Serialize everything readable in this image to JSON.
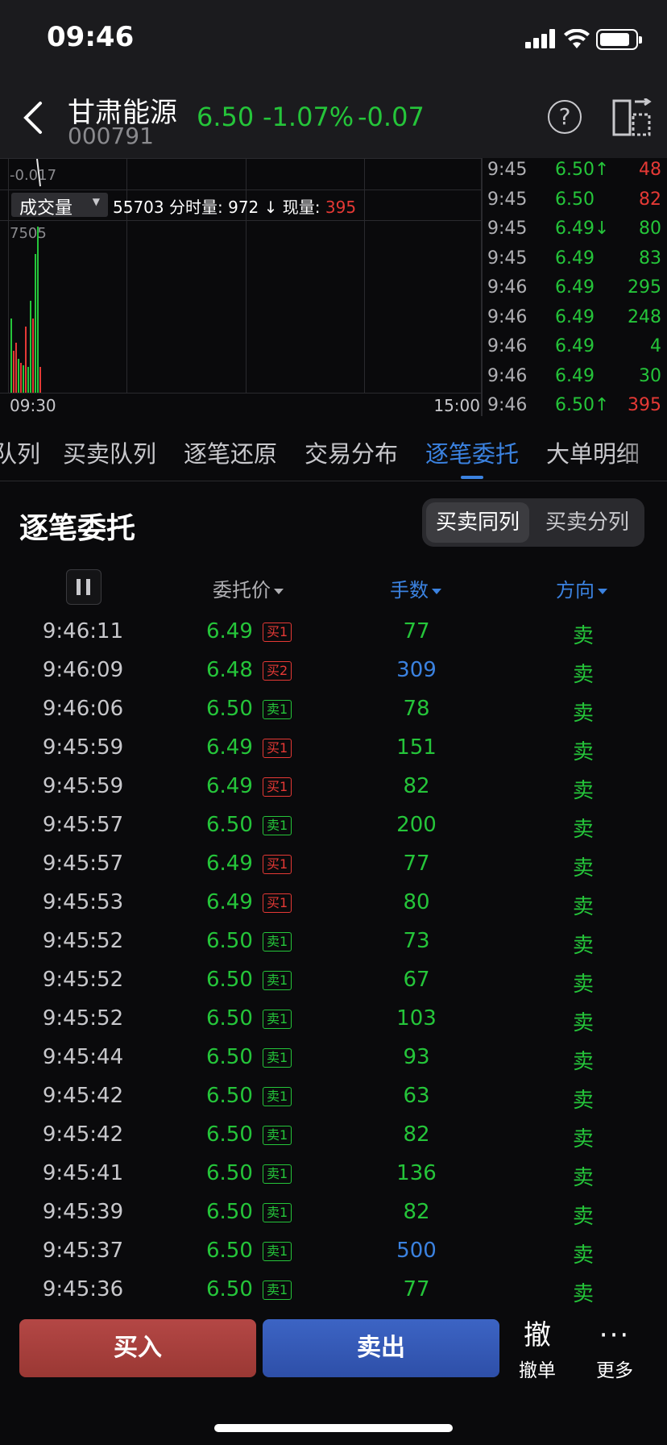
{
  "status": {
    "time": "09:46"
  },
  "stock": {
    "name": "甘肃能源",
    "code": "000791",
    "price": "6.50",
    "change_pct": "-1.07%",
    "change": "-0.07"
  },
  "chart": {
    "ref_label": "-0.017",
    "vol_selector": "成交量",
    "vol_total": "55703",
    "vol_minute_label": "分时量:",
    "vol_minute": "972",
    "vol_now_label": "现量:",
    "vol_now": "395",
    "vol_scale": "7505",
    "x_start": "09:30",
    "x_end": "15:00"
  },
  "ticks": [
    {
      "t": "9:45",
      "p": "6.50↑",
      "v": "48",
      "vc": "#e53935"
    },
    {
      "t": "9:45",
      "p": "6.50",
      "v": "82",
      "vc": "#e53935"
    },
    {
      "t": "9:45",
      "p": "6.49↓",
      "v": "80",
      "vc": "#25c53a"
    },
    {
      "t": "9:45",
      "p": "6.49",
      "v": "83",
      "vc": "#25c53a"
    },
    {
      "t": "9:46",
      "p": "6.49",
      "v": "295",
      "vc": "#25c53a"
    },
    {
      "t": "9:46",
      "p": "6.49",
      "v": "248",
      "vc": "#25c53a"
    },
    {
      "t": "9:46",
      "p": "6.49",
      "v": "4",
      "vc": "#25c53a"
    },
    {
      "t": "9:46",
      "p": "6.49",
      "v": "30",
      "vc": "#25c53a"
    },
    {
      "t": "9:46",
      "p": "6.50↑",
      "v": "395",
      "vc": "#e53935"
    }
  ],
  "tabs": [
    "队列",
    "买卖队列",
    "逐笔还原",
    "交易分布",
    "逐笔委托",
    "大单明细"
  ],
  "section": {
    "title": "逐笔委托",
    "seg_on": "买卖同列",
    "seg_off": "买卖分列"
  },
  "columns": {
    "price": "委托价",
    "qty": "手数",
    "dir": "方向"
  },
  "orders": [
    {
      "time": "9:46:11",
      "price": "6.49",
      "badge": "买1",
      "bt": "buy",
      "qty": "77",
      "qc": "#25c53a",
      "dir": "卖"
    },
    {
      "time": "9:46:09",
      "price": "6.48",
      "badge": "买2",
      "bt": "buy",
      "qty": "309",
      "qc": "#3b82e0",
      "dir": "卖"
    },
    {
      "time": "9:46:06",
      "price": "6.50",
      "badge": "卖1",
      "bt": "sell",
      "qty": "78",
      "qc": "#25c53a",
      "dir": "卖"
    },
    {
      "time": "9:45:59",
      "price": "6.49",
      "badge": "买1",
      "bt": "buy",
      "qty": "151",
      "qc": "#25c53a",
      "dir": "卖"
    },
    {
      "time": "9:45:59",
      "price": "6.49",
      "badge": "买1",
      "bt": "buy",
      "qty": "82",
      "qc": "#25c53a",
      "dir": "卖"
    },
    {
      "time": "9:45:57",
      "price": "6.50",
      "badge": "卖1",
      "bt": "sell",
      "qty": "200",
      "qc": "#25c53a",
      "dir": "卖"
    },
    {
      "time": "9:45:57",
      "price": "6.49",
      "badge": "买1",
      "bt": "buy",
      "qty": "77",
      "qc": "#25c53a",
      "dir": "卖"
    },
    {
      "time": "9:45:53",
      "price": "6.49",
      "badge": "买1",
      "bt": "buy",
      "qty": "80",
      "qc": "#25c53a",
      "dir": "卖"
    },
    {
      "time": "9:45:52",
      "price": "6.50",
      "badge": "卖1",
      "bt": "sell",
      "qty": "73",
      "qc": "#25c53a",
      "dir": "卖"
    },
    {
      "time": "9:45:52",
      "price": "6.50",
      "badge": "卖1",
      "bt": "sell",
      "qty": "67",
      "qc": "#25c53a",
      "dir": "卖"
    },
    {
      "time": "9:45:52",
      "price": "6.50",
      "badge": "卖1",
      "bt": "sell",
      "qty": "103",
      "qc": "#25c53a",
      "dir": "卖"
    },
    {
      "time": "9:45:44",
      "price": "6.50",
      "badge": "卖1",
      "bt": "sell",
      "qty": "93",
      "qc": "#25c53a",
      "dir": "卖"
    },
    {
      "time": "9:45:42",
      "price": "6.50",
      "badge": "卖1",
      "bt": "sell",
      "qty": "63",
      "qc": "#25c53a",
      "dir": "卖"
    },
    {
      "time": "9:45:42",
      "price": "6.50",
      "badge": "卖1",
      "bt": "sell",
      "qty": "82",
      "qc": "#25c53a",
      "dir": "卖"
    },
    {
      "time": "9:45:41",
      "price": "6.50",
      "badge": "卖1",
      "bt": "sell",
      "qty": "136",
      "qc": "#25c53a",
      "dir": "卖"
    },
    {
      "time": "9:45:39",
      "price": "6.50",
      "badge": "卖1",
      "bt": "sell",
      "qty": "82",
      "qc": "#25c53a",
      "dir": "卖"
    },
    {
      "time": "9:45:37",
      "price": "6.50",
      "badge": "卖1",
      "bt": "sell",
      "qty": "500",
      "qc": "#3b82e0",
      "dir": "卖"
    },
    {
      "time": "9:45:36",
      "price": "6.50",
      "badge": "卖1",
      "bt": "sell",
      "qty": "77",
      "qc": "#25c53a",
      "dir": "卖"
    }
  ],
  "bottom": {
    "buy": "买入",
    "sell": "卖出",
    "cancel_glyph": "撤",
    "cancel": "撤单",
    "more": "更多"
  },
  "colors": {
    "up": "#e53935",
    "down": "#25c53a",
    "accent": "#3b82e0"
  }
}
